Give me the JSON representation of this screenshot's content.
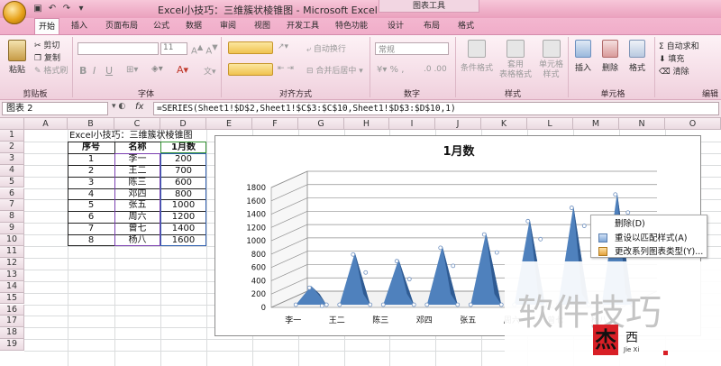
{
  "window": {
    "title": "Excel小技巧：三维簇状棱锥图 - Microsoft Excel",
    "chart_tools": "图表工具"
  },
  "tabs": [
    {
      "label": "开始",
      "active": true
    },
    {
      "label": "插入"
    },
    {
      "label": "页面布局"
    },
    {
      "label": "公式"
    },
    {
      "label": "数据"
    },
    {
      "label": "审阅"
    },
    {
      "label": "视图"
    },
    {
      "label": "开发工具"
    },
    {
      "label": "特色功能"
    },
    {
      "label": "设计"
    },
    {
      "label": "布局"
    },
    {
      "label": "格式"
    }
  ],
  "ribbon": {
    "clipboard": {
      "paste": "粘贴",
      "cut": "剪切",
      "copy": "复制",
      "format_painter": "格式刷",
      "group": "剪贴板"
    },
    "font": {
      "size": "11",
      "group": "字体"
    },
    "alignment": {
      "wrap": "自动换行",
      "merge": "合并后居中",
      "group": "对齐方式"
    },
    "number": {
      "format": "常规",
      "group": "数字"
    },
    "styles": {
      "cond": "条件格式",
      "table": "套用\n表格格式",
      "cell": "单元格\n样式",
      "group": "样式"
    },
    "cells": {
      "insert": "插入",
      "delete": "删除",
      "format": "格式",
      "group": "单元格"
    },
    "editing": {
      "autosum": "自动求和",
      "fill": "填充",
      "clear": "清除",
      "group": "编辑"
    }
  },
  "formula_bar": {
    "name_box": "图表 2",
    "fx": "fx",
    "formula": "=SERIES(Sheet1!$D$2,Sheet1!$C$3:$C$10,Sheet1!$D$3:$D$10,1)"
  },
  "columns": [
    "A",
    "B",
    "C",
    "D",
    "E",
    "F",
    "G",
    "H",
    "I",
    "J",
    "K",
    "L",
    "M",
    "N",
    "O"
  ],
  "rows": [
    "1",
    "2",
    "3",
    "4",
    "5",
    "6",
    "7",
    "8",
    "9",
    "10",
    "11",
    "12",
    "13",
    "14",
    "15",
    "16",
    "17",
    "18",
    "19"
  ],
  "sheet": {
    "title": "Excel小技巧：三维簇状棱锥图",
    "headers": [
      "序号",
      "名称",
      "1月数"
    ],
    "rows": [
      [
        "1",
        "李一",
        "200"
      ],
      [
        "2",
        "王二",
        "700"
      ],
      [
        "3",
        "陈三",
        "600"
      ],
      [
        "4",
        "邓四",
        "800"
      ],
      [
        "5",
        "张五",
        "1000"
      ],
      [
        "6",
        "周六",
        "1200"
      ],
      [
        "7",
        "曾七",
        "1400"
      ],
      [
        "8",
        "杨八",
        "1600"
      ]
    ]
  },
  "chart_data": {
    "type": "bar",
    "title": "1月数",
    "categories": [
      "李一",
      "王二",
      "陈三",
      "邓四",
      "张五",
      "周六",
      "曾七",
      "杨八"
    ],
    "values": [
      200,
      700,
      600,
      800,
      1000,
      1200,
      1400,
      1600
    ],
    "ylim": [
      0,
      1800
    ],
    "yticks": [
      "0",
      "200",
      "400",
      "600",
      "800",
      "1000",
      "1200",
      "1400",
      "1600",
      "1800"
    ],
    "grid": true,
    "color": "#4f81bd"
  },
  "context_menu": [
    "删除(D)",
    "重设以匹配样式(A)",
    "更改系列图表类型(Y)..."
  ],
  "watermark": {
    "text": "软件技巧",
    "logo_char": "杰",
    "logo_char2": "西",
    "sub": "Jie Xi"
  }
}
